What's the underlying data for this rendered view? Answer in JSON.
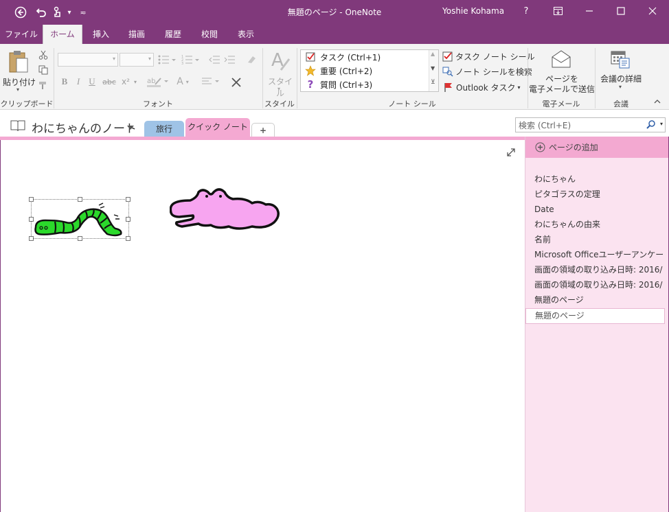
{
  "titlebar": {
    "title": "無題のページ - OneNote",
    "user": "Yoshie Kohama",
    "help": "?",
    "qat_more": "▾",
    "qat_customize": "≂"
  },
  "menu": {
    "tabs": [
      "ファイル",
      "ホーム",
      "挿入",
      "描画",
      "履歴",
      "校閲",
      "表示"
    ]
  },
  "ribbon": {
    "clipboard": {
      "paste_label": "貼り付け",
      "group_label": "クリップボード"
    },
    "font": {
      "group_label": "フォント",
      "bold": "B",
      "italic": "I",
      "underline": "U",
      "strike": "abc",
      "superscript": "x²",
      "font_color": "A"
    },
    "style": {
      "label": "スタイル",
      "group_label": "スタイル"
    },
    "tags": {
      "items": [
        {
          "label": "タスク (Ctrl+1)",
          "icon": "checkbox-icon"
        },
        {
          "label": "重要 (Ctrl+2)",
          "icon": "star-icon"
        },
        {
          "label": "質問 (Ctrl+3)",
          "icon": "question-icon"
        }
      ],
      "todo_tag": "タスク ノート シール",
      "find_tags": "ノート シールを検索",
      "outlook_tasks": "Outlook タスク",
      "group_label": "ノート シール"
    },
    "email": {
      "line1": "ページを",
      "line2": "電子メールで送信",
      "group_label": "電子メール"
    },
    "meetings": {
      "label": "会議の詳細",
      "group_label": "会議"
    }
  },
  "notebook": {
    "name": "わにちゃんのノート",
    "sections": [
      "旅行",
      "クイック ノート"
    ],
    "add_section": "+",
    "search_placeholder": "検索 (Ctrl+E)"
  },
  "pages": {
    "add_page": "ページの追加",
    "items": [
      "わにちゃん",
      "ピタゴラスの定理",
      "Date",
      "わにちゃんの由来",
      "名前",
      "Microsoft Officeユーザーアンケート",
      "画面の領域の取り込み日時: 2016/",
      "画面の領域の取り込み日時: 2016/",
      "無題のページ",
      "無題のページ"
    ]
  },
  "colors": {
    "accent": "#80397b",
    "section_pink": "#f4a9d2",
    "section_blue": "#9fc3e6",
    "page_pane": "#fbe3f0"
  }
}
